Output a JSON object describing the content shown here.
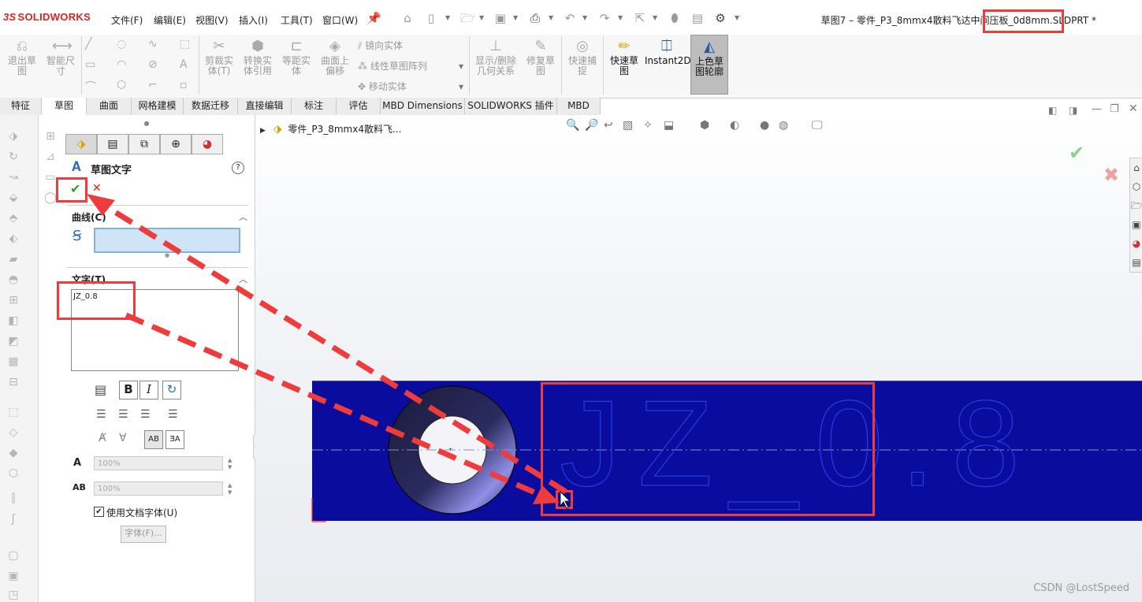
{
  "app": {
    "logo": "SOLIDWORKS",
    "logo_prefix": "3S"
  },
  "menu": [
    "文件(F)",
    "编辑(E)",
    "视图(V)",
    "插入(I)",
    "工具(T)",
    "窗口(W)"
  ],
  "document_title": "草图7 – 零件_P3_8mmx4散料飞达中间压板_0d8mm.SLDPRT *",
  "commands": {
    "exit_sketch": "退出草\n图",
    "smart_dimension": "智能尺\n寸",
    "trim": "剪裁实\n体(T)",
    "convert": "转换实\n体引用",
    "offset": "等距实\n体",
    "surface_offset": "曲面上\n偏移",
    "mirror": "镜向实体",
    "linear_pattern": "线性草图阵列",
    "move": "移动实体",
    "display_relations": "显示/删除\n几何关系",
    "repair_sketch": "修复草\n图",
    "quick_snaps": "快速捕\n捉",
    "rapid_sketch": "快速草\n图",
    "instant2d": "Instant2D",
    "shaded_sketch": "上色草\n图轮廓"
  },
  "tabs": [
    "特征",
    "草图",
    "曲面",
    "网格建模",
    "数据迁移",
    "直接编辑",
    "标注",
    "评估",
    "MBD Dimensions",
    "SOLIDWORKS 插件",
    "MBD"
  ],
  "selected_tab": "草图",
  "feature_tree": {
    "part_name": "零件_P3_8mmx4散料飞..."
  },
  "property_manager": {
    "title": "草图文字",
    "ok_symbol": "✔",
    "cancel_symbol": "✕",
    "curve_section": {
      "title": "曲线(C)"
    },
    "text_section": {
      "title": "文字(T)",
      "value": "JZ_0.8"
    },
    "format_buttons": [
      "B",
      "I"
    ],
    "width_factor": "100%",
    "spacing": "100%",
    "use_doc_font": {
      "label": "使用文档字体(U)",
      "checked": true
    },
    "font_button": "字体(F)..."
  },
  "graphics": {
    "sketch_text": "JZ_0.8"
  },
  "watermark": "CSDN @LostSpeed",
  "colors": {
    "part_blue": "#0a0c9e",
    "annotation_red": "#ef3b3b",
    "ok_green": "#2e9e2e",
    "cancel_red": "#d22"
  }
}
